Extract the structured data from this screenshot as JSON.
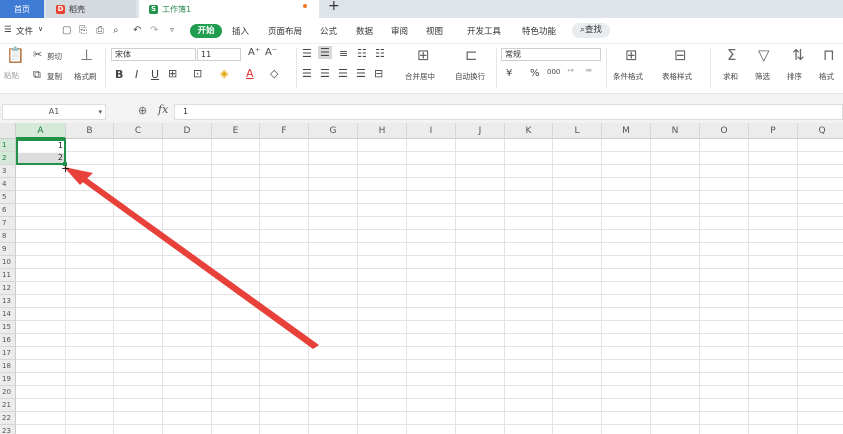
{
  "tabs": {
    "home": "首页",
    "daoke": "稻壳",
    "workbook": "工作簿1",
    "add": "+"
  },
  "menu": {
    "hamburger": "☰",
    "file": "文件",
    "file_arrow": "∨",
    "start": "开始",
    "insert": "插入",
    "layout": "页面布局",
    "formula": "公式",
    "data": "数据",
    "review": "审阅",
    "view": "视图",
    "dev": "开发工具",
    "special": "特色功能",
    "search": "查找"
  },
  "ribbon": {
    "paste": "粘贴",
    "cut": "剪切",
    "copy": "复制",
    "format_painter": "格式刷",
    "font_name": "宋体",
    "font_size": "11",
    "grow": "A⁺",
    "shrink": "A⁻",
    "bold": "B",
    "italic": "I",
    "underline": "U",
    "merge": "合并居中",
    "wrap": "自动换行",
    "number_format": "常规",
    "currency": "¥",
    "percent": "%",
    "thousand": "000",
    "cond_format": "条件格式",
    "table_style": "表格样式",
    "sum": "求和",
    "filter": "筛选",
    "sort": "排序",
    "format": "格式"
  },
  "formula_bar": {
    "name_box": "A1",
    "fx": "fx",
    "value": "1"
  },
  "columns": [
    "A",
    "B",
    "C",
    "D",
    "E",
    "F",
    "G",
    "H",
    "I",
    "J",
    "K",
    "L",
    "M",
    "N",
    "O",
    "P",
    "Q"
  ],
  "rows": [
    "1",
    "2",
    "3",
    "4",
    "5",
    "6",
    "7",
    "8",
    "9",
    "10",
    "11",
    "12",
    "13",
    "14",
    "15",
    "16",
    "17",
    "18",
    "19",
    "20",
    "21",
    "22",
    "23"
  ],
  "cells": {
    "A1": "1",
    "A2": "2"
  },
  "colors": {
    "accent_green": "#22914a",
    "start_button": "#1e9e4e",
    "home_tab": "#3d7bd4",
    "arrow_red": "#e8413a"
  }
}
